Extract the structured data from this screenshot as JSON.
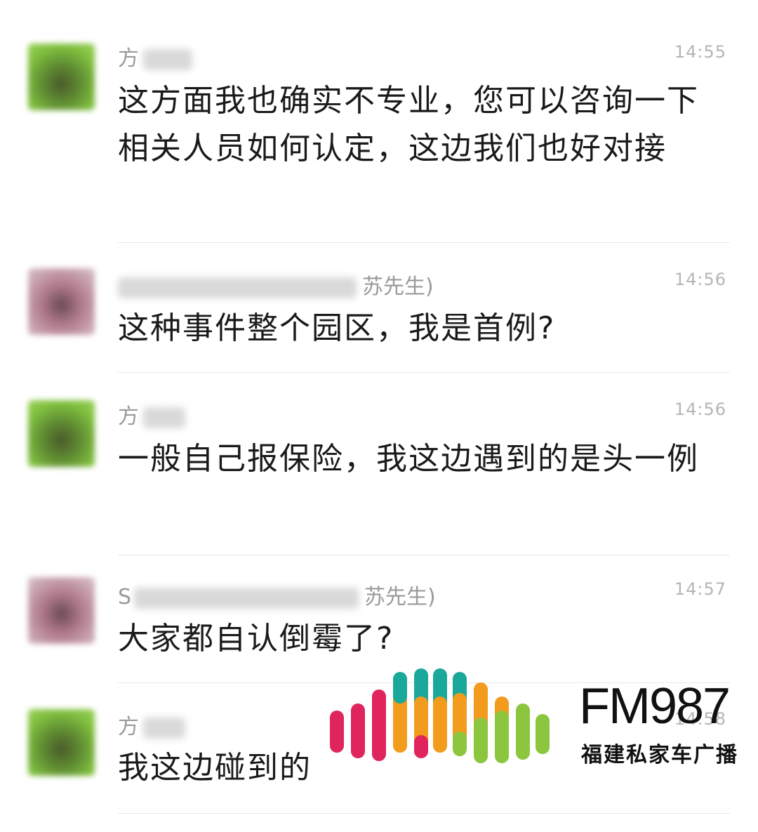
{
  "messages": [
    {
      "name": "方",
      "name_suffix": "",
      "time": "14:55",
      "text": "这方面我也确实不专业，您可以咨询一下相关人员如何认定，这边我们也好对接",
      "avatar": "green"
    },
    {
      "name": "",
      "name_suffix": "苏先生)",
      "time": "14:56",
      "text": "这种事件整个园区，我是首例?",
      "avatar": "pink"
    },
    {
      "name": "方",
      "name_suffix": "",
      "time": "14:56",
      "text": "一般自己报保险，我这边遇到的是头一例",
      "avatar": "green"
    },
    {
      "name": "S",
      "name_suffix": "苏先生)",
      "time": "14:57",
      "text": "大家都自认倒霉了?",
      "avatar": "pink"
    },
    {
      "name": "方",
      "name_suffix": "",
      "time": "14:58",
      "text": "我这边碰到的",
      "avatar": "green"
    }
  ],
  "watermark": {
    "title": "FM987",
    "subtitle": "福建私家车广播",
    "colors": {
      "pink": "#e0245e",
      "orange": "#f29b1d",
      "teal": "#1aa89a",
      "green": "#8cc63f"
    }
  }
}
